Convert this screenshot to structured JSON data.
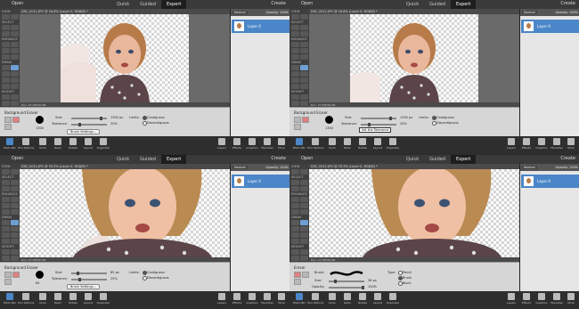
{
  "app": {
    "open_label": "Open",
    "modes": [
      "Quick",
      "Guided",
      "Expert"
    ],
    "active_mode": "Expert",
    "create_label": "Create"
  },
  "toolbox": {
    "sections": [
      "VIEW",
      "SELECT",
      "ENHANCE",
      "DRAW",
      "MODIFY",
      "COLOR"
    ]
  },
  "layers_panel": {
    "blend_mode": "Normal",
    "opacity_label": "Opacity:",
    "opacity_value": "100%",
    "layer_name": "Layer 0"
  },
  "bottom_bar": {
    "left": [
      "Photo Bin",
      "Tool Options",
      "Undo",
      "Redo",
      "Rotate",
      "Layout",
      "Organizer"
    ],
    "right": [
      "Layers",
      "Effects",
      "Graphics",
      "Favorites",
      "More"
    ]
  },
  "panels": [
    {
      "doc_title": "DSC_0011.JPG @ 16.8% (Layer 0, RGB/8) *",
      "zoom": "16.8%",
      "status": "Doc: 27.3M/36.0M",
      "tool_title": "Background Eraser",
      "brush_size": "1300",
      "size_label": "Size:",
      "size_value": "1300 px",
      "tolerance_label": "Tolerance:",
      "tolerance_value": "20%",
      "limits_label": "Limits:",
      "contiguous": "Contiguous",
      "discontiguous": "Discontiguous",
      "button_label": "Brush Settings...",
      "tooltip": ""
    },
    {
      "doc_title": "DSC_0011.JPG @ 16.8% (Layer 0, RGB/8) *",
      "zoom": "16.8%",
      "status": "Doc: 27.3M/36.0M",
      "tool_title": "Background Eraser",
      "brush_size": "1300",
      "size_label": "Size:",
      "size_value": "1300 px",
      "tolerance_label": "Tolerance:",
      "tolerance_value": "20%",
      "limits_label": "Limits:",
      "contiguous": "Contiguous",
      "discontiguous": "Discontiguous",
      "button_label": "",
      "tooltip": "Set the Tolerance"
    },
    {
      "doc_title": "DSC_0011.JPG @ 33.3% (Layer 0, RGB/8) *",
      "zoom": "33.33%",
      "status": "Doc: 27.3M/36.0M",
      "tool_title": "Background Eraser",
      "brush_size": "85",
      "size_label": "Size:",
      "size_value": "85 px",
      "tolerance_label": "Tolerance:",
      "tolerance_value": "20%",
      "limits_label": "Limits:",
      "contiguous": "Contiguous",
      "discontiguous": "Discontiguous",
      "button_label": "Brush Settings...",
      "tooltip": ""
    },
    {
      "doc_title": "DSC_0011.JPG @ 33.3% (Layer 0, RGB/8) *",
      "zoom": "33.33%",
      "status": "Doc: 27.3M/36.0M",
      "tool_title": "Eraser",
      "brush_label": "Brush:",
      "size_label": "Size:",
      "size_value": "36 px",
      "opacity_label": "Opacity:",
      "opacity_value": "100%",
      "type_label": "Type:",
      "types": [
        "Pencil",
        "Brush",
        "Block"
      ]
    }
  ],
  "colors": {
    "accent": "#4a86c8",
    "active_tool": "#e08080"
  }
}
